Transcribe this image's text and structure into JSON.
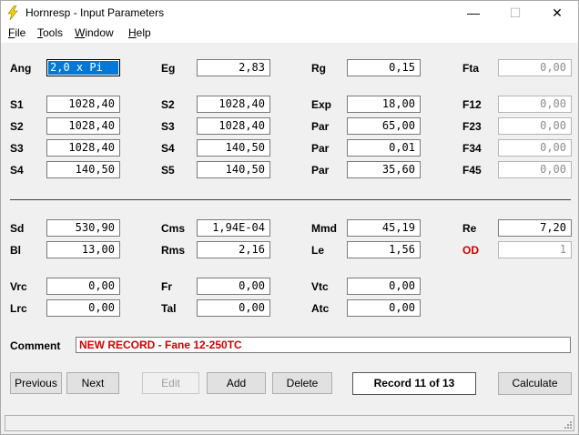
{
  "window": {
    "title": "Hornresp - Input Parameters",
    "icon": "lightning-icon",
    "controls": {
      "minimize": "—",
      "maximize": "☐",
      "close": "✕"
    }
  },
  "menu": [
    {
      "accel": "F",
      "rest": "ile"
    },
    {
      "accel": "T",
      "rest": "ools"
    },
    {
      "accel": "W",
      "rest": "indow"
    },
    {
      "accel": "H",
      "rest": "elp"
    }
  ],
  "params": {
    "ang": {
      "label": "Ang",
      "value": "2,0 x Pi"
    },
    "eg": {
      "label": "Eg",
      "value": "2,83"
    },
    "rg": {
      "label": "Rg",
      "value": "0,15"
    },
    "fta": {
      "label": "Fta",
      "value": "0,00"
    },
    "s1a": {
      "label": "S1",
      "value": "1028,40"
    },
    "s2b": {
      "label": "S2",
      "value": "1028,40"
    },
    "exp": {
      "label": "Exp",
      "value": "18,00"
    },
    "f12": {
      "label": "F12",
      "value": "0,00"
    },
    "s2a": {
      "label": "S2",
      "value": "1028,40"
    },
    "s3b": {
      "label": "S3",
      "value": "1028,40"
    },
    "par1": {
      "label": "Par",
      "value": "65,00"
    },
    "f23": {
      "label": "F23",
      "value": "0,00"
    },
    "s3a": {
      "label": "S3",
      "value": "1028,40"
    },
    "s4b": {
      "label": "S4",
      "value": "140,50"
    },
    "par2": {
      "label": "Par",
      "value": "0,01"
    },
    "f34": {
      "label": "F34",
      "value": "0,00"
    },
    "s4a": {
      "label": "S4",
      "value": "140,50"
    },
    "s5b": {
      "label": "S5",
      "value": "140,50"
    },
    "par3": {
      "label": "Par",
      "value": "35,60"
    },
    "f45": {
      "label": "F45",
      "value": "0,00"
    },
    "sd": {
      "label": "Sd",
      "value": "530,90"
    },
    "cms": {
      "label": "Cms",
      "value": "1,94E-04"
    },
    "mmd": {
      "label": "Mmd",
      "value": "45,19"
    },
    "re": {
      "label": "Re",
      "value": "7,20"
    },
    "bl": {
      "label": "Bl",
      "value": "13,00"
    },
    "rms": {
      "label": "Rms",
      "value": "2,16"
    },
    "le": {
      "label": "Le",
      "value": "1,56"
    },
    "od": {
      "label": "OD",
      "value": "1"
    },
    "vrc": {
      "label": "Vrc",
      "value": "0,00"
    },
    "fr": {
      "label": "Fr",
      "value": "0,00"
    },
    "vtc": {
      "label": "Vtc",
      "value": "0,00"
    },
    "lrc": {
      "label": "Lrc",
      "value": "0,00"
    },
    "tal": {
      "label": "Tal",
      "value": "0,00"
    },
    "atc": {
      "label": "Atc",
      "value": "0,00"
    }
  },
  "comment": {
    "label": "Comment",
    "value": "NEW RECORD - Fane 12-250TC"
  },
  "buttons": {
    "previous": "Previous",
    "next": "Next",
    "edit": "Edit",
    "add": "Add",
    "delete": "Delete",
    "calculate": "Calculate"
  },
  "record": "Record 11 of 13",
  "colors": {
    "label_red": "#d00000",
    "selection": "#0078d7",
    "icon_yellow": "#f2d400"
  }
}
